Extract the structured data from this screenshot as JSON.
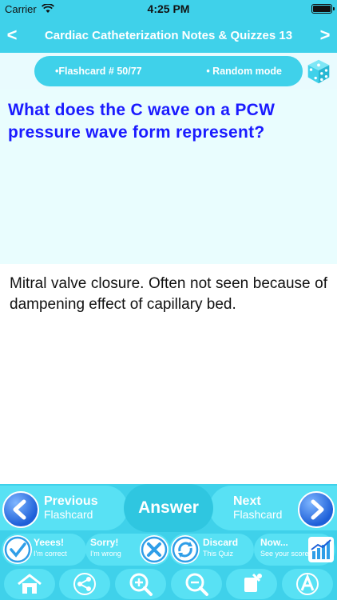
{
  "status_bar": {
    "carrier": "Carrier",
    "time": "4:25 PM"
  },
  "nav": {
    "back": "<",
    "title": "Cardiac Catheterization Notes & Quizzes 13",
    "forward": ">"
  },
  "card_header": {
    "flashcard_label": "•Flashcard #  50/77",
    "mode_label": "• Random mode"
  },
  "question": "What does the C wave on a PCW pressure wave form represent?",
  "answer": "Mitral valve closure. Often not seen because of dampening effect of capillary bed.",
  "controls": {
    "previous": {
      "line1": "Previous",
      "line2": "Flashcard"
    },
    "answer_label": "Answer",
    "next": {
      "line1": "Next",
      "line2": "Flashcard"
    },
    "yes": {
      "line1": "Yeees!",
      "line2": "I'm correct"
    },
    "sorry": {
      "line1": "Sorry!",
      "line2": "I'm wrong"
    },
    "discard": {
      "line1": "Discard",
      "line2": "This Quiz"
    },
    "now": {
      "line1": "Now...",
      "line2": "See your score"
    }
  },
  "toolbar": [
    "home-icon",
    "share-icon",
    "zoom-in-icon",
    "zoom-out-icon",
    "bookmark-icon",
    "font-icon"
  ],
  "colors": {
    "accent": "#3fd1ea",
    "question_text": "#1a1aff",
    "question_bg": "#e9fdfe"
  }
}
